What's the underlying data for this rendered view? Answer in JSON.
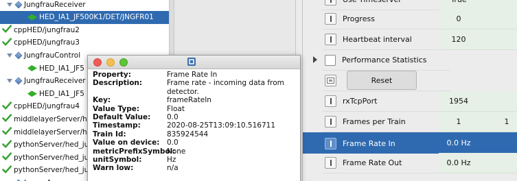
{
  "tree": {
    "items": [
      {
        "label": "JungfrauReceiver",
        "kind": "class",
        "indent": 1
      },
      {
        "label": "HED_IA1_JF500K1/DET/JNGFR01",
        "kind": "device",
        "indent": 2,
        "selected": true
      },
      {
        "label": "cppHED/jungfrau2",
        "kind": "server",
        "indent": 0
      },
      {
        "label": "cppHED/jungfrau3",
        "kind": "server",
        "indent": 0
      },
      {
        "label": "JungfrauControl",
        "kind": "class",
        "indent": 1
      },
      {
        "label": "HED_IA1_JF5",
        "kind": "device",
        "indent": 2
      },
      {
        "label": "JungfrauReceiver",
        "kind": "class",
        "indent": 1
      },
      {
        "label": "HED_IA1_JF5",
        "kind": "device",
        "indent": 2
      },
      {
        "label": "cppHED/jungfrau4",
        "kind": "server",
        "indent": 0
      },
      {
        "label": "middlelayerServer/hed_j",
        "kind": "server",
        "indent": 0
      },
      {
        "label": "middlelayerServer/hed_j",
        "kind": "server",
        "indent": 0
      },
      {
        "label": "pythonServer/hed_ju",
        "kind": "server",
        "indent": 0
      },
      {
        "label": "pythonServer/hed_ju",
        "kind": "server",
        "indent": 0
      },
      {
        "label": "pythonServer/hed_ju",
        "kind": "server",
        "indent": 0
      },
      {
        "label": "ImageAverager",
        "kind": "class",
        "indent": 1
      }
    ]
  },
  "tooltip": {
    "rows": [
      {
        "key": "Property:",
        "value": "Frame Rate In"
      },
      {
        "key": "Description:",
        "value": "Frame rate - incoming data from detector."
      },
      {
        "key": "Key:",
        "value": "frameRateIn"
      },
      {
        "key": "Value Type:",
        "value": "Float"
      },
      {
        "key": "Default Value:",
        "value": "0.0"
      },
      {
        "key": "Timestamp:",
        "value": "2020-08-25T13:09:10.516711"
      },
      {
        "key": "Train Id:",
        "value": "835924544"
      },
      {
        "key": "Value on device:",
        "value": "0.0"
      },
      {
        "key": "metricPrefixSymbol:",
        "value": "None"
      },
      {
        "key": "unitSymbol:",
        "value": "Hz"
      },
      {
        "key": "Warn low:",
        "value": "n/a"
      }
    ]
  },
  "properties": {
    "rows": [
      {
        "label": "Use Timeserver",
        "value": "True",
        "icon": "bar"
      },
      {
        "label": "Progress",
        "value": "0",
        "icon": "bar"
      },
      {
        "label": "Heartbeat interval",
        "value": "120",
        "icon": "bar"
      },
      {
        "label": "Performance Statistics",
        "value": "",
        "icon": "box"
      },
      {
        "label": "",
        "value": "",
        "icon": "command"
      },
      {
        "label": "rxTcpPort",
        "value": "1954",
        "icon": "bar"
      },
      {
        "label": "Frames per Train",
        "value": "1",
        "extra": "1",
        "icon": "bar"
      },
      {
        "label": "Frame Rate In",
        "value": "0.0 Hz",
        "icon": "bar",
        "selected": true
      },
      {
        "label": "Frame Rate Out",
        "value": "0.0 Hz",
        "icon": "bar"
      }
    ],
    "reset_label": "Reset"
  },
  "colors": {
    "selection": "#2f6ab0",
    "value_bg": "#e6f0e6",
    "check_green": "#3aa335",
    "close_light": "#ee5d57",
    "min_light": "#f4bf4f",
    "max_light": "#5fc438"
  }
}
